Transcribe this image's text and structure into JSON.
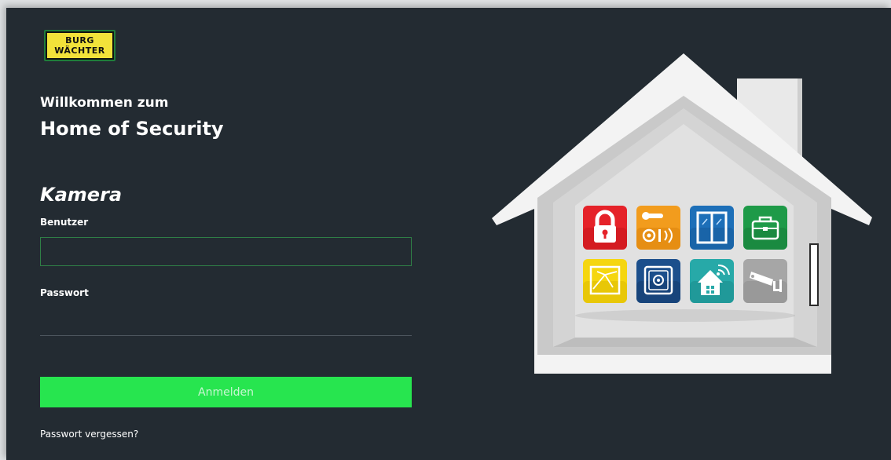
{
  "brand": {
    "logo_line1": "BURG",
    "logo_line2": "WÄCHTER",
    "logo_bg": "#f2e23a",
    "logo_frame": "#1f7d3a"
  },
  "welcome": {
    "line1": "Willkommen zum",
    "line2": "Home of Security"
  },
  "login": {
    "title": "Kamera",
    "user_label": "Benutzer",
    "user_value": "",
    "password_label": "Passwort",
    "password_value": "",
    "submit_label": "Anmelden",
    "forgot_label": "Passwort vergessen?"
  },
  "colors": {
    "background": "#232b32",
    "accent_green": "#27e54f",
    "input_border": "#2f7f46"
  },
  "illustration": {
    "tiles": [
      {
        "icon": "padlock-icon",
        "color": "#e52229"
      },
      {
        "icon": "door-handle-icon",
        "color": "#f29c1d"
      },
      {
        "icon": "window-icon",
        "color": "#1d6fb8"
      },
      {
        "icon": "toolbox-icon",
        "color": "#1e9a48"
      },
      {
        "icon": "motion-sensor-icon",
        "color": "#f5d60f"
      },
      {
        "icon": "safe-icon",
        "color": "#1c4f8c"
      },
      {
        "icon": "smart-home-icon",
        "color": "#27a9a8"
      },
      {
        "icon": "security-camera-icon",
        "color": "#a6a6a6"
      }
    ]
  }
}
